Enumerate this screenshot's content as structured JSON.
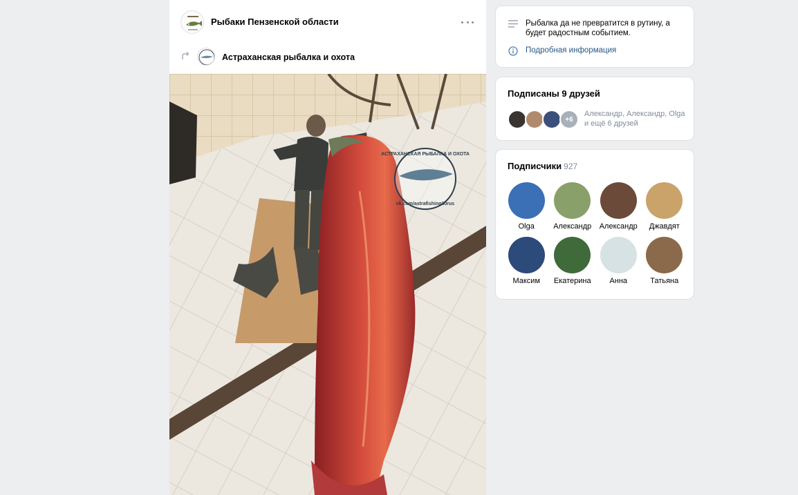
{
  "post": {
    "group_name": "Рыбаки Пензенской области",
    "group_avatar_icon": "fish-logo-icon",
    "more_icon": "more-dots-icon",
    "repost_icon": "repost-arrow-icon",
    "source_name": "Астраханская рыбалка и охота",
    "photo": {
      "watermark_line1": "АСТРАХАНСКАЯ РЫБАЛКА И ОХОТА",
      "watermark_line2": "vk.com/astrafishing30rus"
    }
  },
  "about": {
    "description": "Рыбалка да не превратится в рутину, а будет радостным событием.",
    "info_link": "Подробная информация"
  },
  "friends": {
    "title": "Подписаны 9 друзей",
    "more_badge": "+6",
    "names_text": "Александр, Александр, Olga и ещё 6 друзей"
  },
  "subscribers": {
    "title": "Подписчики",
    "count": "927",
    "members": [
      {
        "name": "Olga",
        "color": "#3b6fb6"
      },
      {
        "name": "Александр",
        "color": "#8aa06a"
      },
      {
        "name": "Александр",
        "color": "#6b4a3a"
      },
      {
        "name": "Джавдят",
        "color": "#c9a36a"
      },
      {
        "name": "Максим",
        "color": "#2c4a7a"
      },
      {
        "name": "Екатерина",
        "color": "#3f6a3a"
      },
      {
        "name": "Анна",
        "color": "#d7e2e4"
      },
      {
        "name": "Татьяна",
        "color": "#8a6a4a"
      }
    ]
  }
}
